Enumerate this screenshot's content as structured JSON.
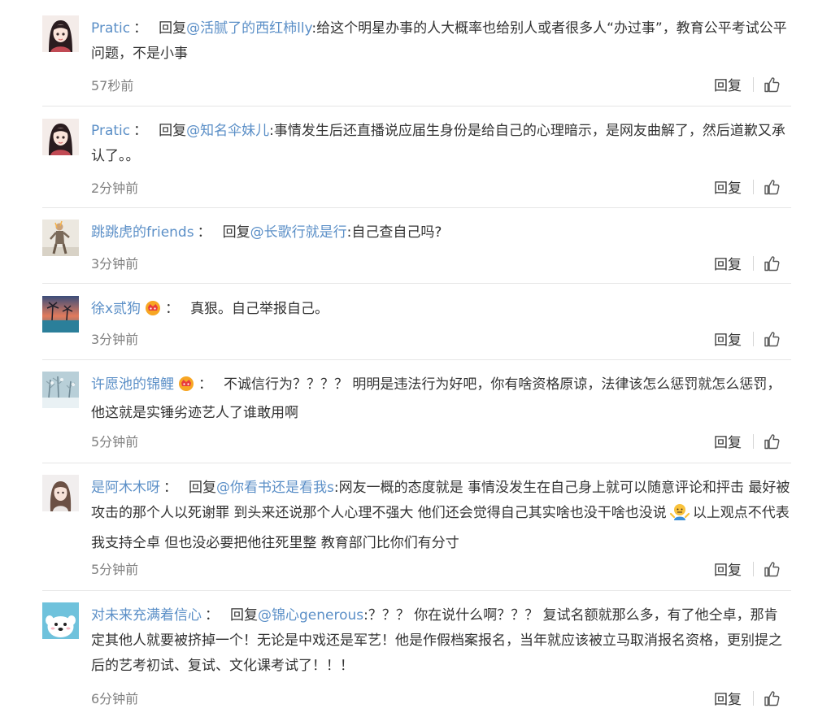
{
  "comments": [
    {
      "username": "Pratic",
      "colon": "：",
      "reply_prefix": "回复",
      "mention": "@活腻了的西红柿lly",
      "text": ":给这个明星办事的人大概率也给别人或者很多人“办过事”，教育公平考试公平问题，不是小事",
      "time": "57秒前",
      "reply_label": "回复",
      "avatar_icon": "anime-girl-avatar"
    },
    {
      "username": "Pratic",
      "colon": "：",
      "reply_prefix": "回复",
      "mention": "@知名伞妹儿",
      "text": ":事情发生后还直播说应届生身份是给自己的心理暗示，是网友曲解了，然后道歉又承认了。。",
      "time": "2分钟前",
      "reply_label": "回复",
      "avatar_icon": "anime-girl-avatar"
    },
    {
      "username": "跳跳虎的friends",
      "colon": "：",
      "reply_prefix": "回复",
      "mention": "@长歌行就是行",
      "text": ":自己查自己吗?",
      "time": "3分钟前",
      "reply_label": "回复",
      "avatar_icon": "figure-photo-avatar"
    },
    {
      "username": "徐x贰狗",
      "colon": "：",
      "text": "真狠。自己举报自己。",
      "time": "3分钟前",
      "reply_label": "回复",
      "avatar_icon": "sunset-palm-avatar",
      "badge_icon": "vip-crown-icon"
    },
    {
      "username": "许愿池的锦鲤",
      "colon": "：",
      "text": "不诚信行为？？？？ 明明是违法行为好吧，你有啥资格原谅，法律该怎么惩罚就怎么惩罚，他这就是实锤劣迹艺人了谁敢用啊",
      "time": "5分钟前",
      "reply_label": "回复",
      "avatar_icon": "snowy-tree-avatar",
      "badge_icon": "vip-crown-icon"
    },
    {
      "username": "是阿木木呀",
      "colon": "：",
      "reply_prefix": "回复",
      "mention": "@你看书还是看我s",
      "text": ":网友一概的态度就是 事情没发生在自己身上就可以随意评论和抨击 最好被攻击的那个人以死谢罪 到头来还说那个人心理不强大 他们还会觉得自己其实啥也没干啥也没说",
      "text_after_emoji": "以上观点不代表我支持仝卓 但也没必要把他往死里整 教育部门比你们有分寸",
      "time": "5分钟前",
      "reply_label": "回复",
      "avatar_icon": "girl-photo-avatar",
      "inline_emoji_icon": "shrug-emoji-icon"
    },
    {
      "username": "对未来充满着信心",
      "colon": "：",
      "reply_prefix": "回复",
      "mention": "@锦心generous",
      "text": ":？？？ 你在说什么啊？？？ 复试名额就那么多，有了他仝卓，那肯定其他人就要被挤掉一个！无论是中戏还是军艺！他是作假档案报名，当年就应该被立马取消报名资格，更别提之后的艺考初试、复试、文化课考试了！！！",
      "time": "6分钟前",
      "reply_label": "回复",
      "avatar_icon": "cartoon-dog-avatar"
    }
  ]
}
